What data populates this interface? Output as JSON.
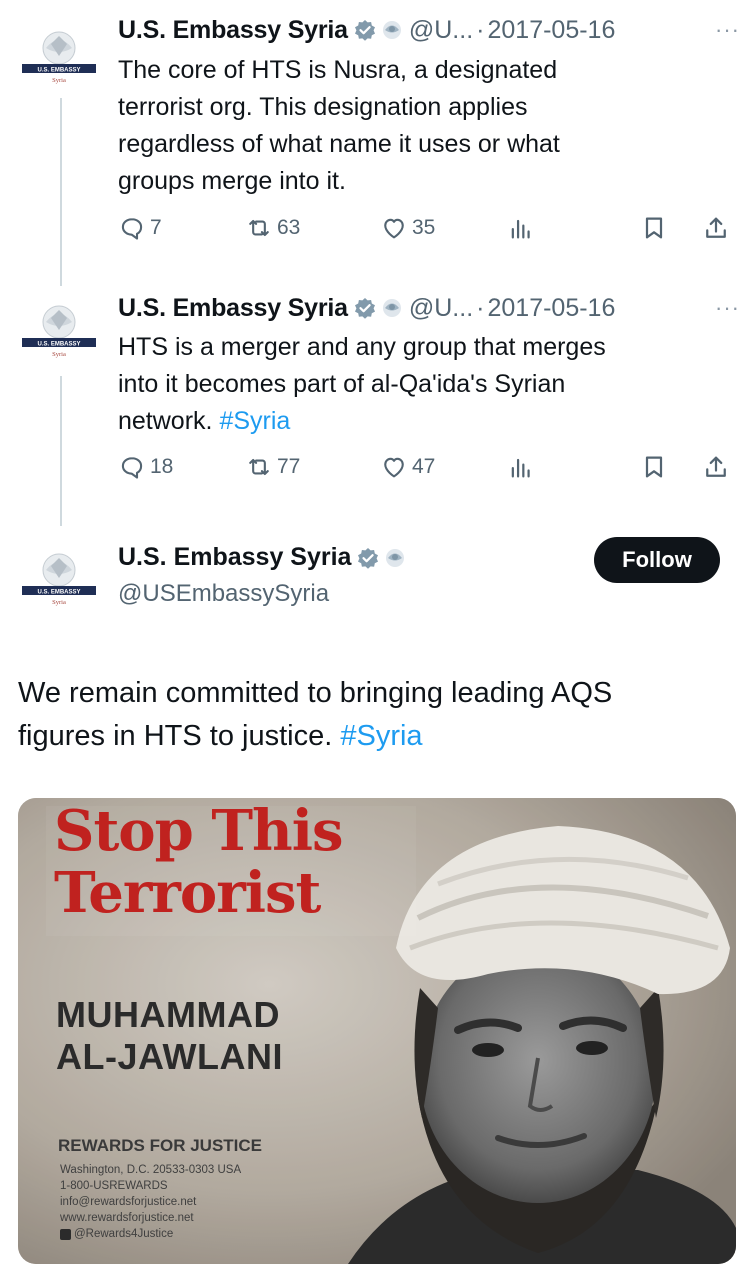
{
  "colors": {
    "accent": "#1d9bf0",
    "text": "#0f1419",
    "muted": "#536471",
    "poster_red": "#c0221f"
  },
  "tweets": [
    {
      "name": "U.S. Embassy Syria",
      "handle": "@U...",
      "separator": "·",
      "date": "2017-05-16",
      "more": "···",
      "text_lines": [
        "The core of HTS is Nusra, a designated",
        "terrorist org. This designation applies",
        "regardless of what name it uses or what",
        "groups merge into it."
      ],
      "replies": "7",
      "retweets": "63",
      "likes": "35",
      "icons": [
        "reply-icon",
        "retweet-icon",
        "like-icon",
        "views-icon",
        "bookmark-icon",
        "share-icon"
      ]
    },
    {
      "name": "U.S. Embassy Syria",
      "handle": "@U...",
      "separator": "·",
      "date": "2017-05-16",
      "more": "···",
      "text_line1": "HTS is a merger and any group that merges",
      "text_line2": "into it becomes part of al-Qa'ida's Syrian",
      "text_line3_prefix": "network. ",
      "hashtag": "#Syria",
      "replies": "18",
      "retweets": "77",
      "likes": "47"
    }
  ],
  "main": {
    "name": "U.S. Embassy Syria",
    "handle": "@USEmbassySyria",
    "follow_label": "Follow",
    "text_line1": "We remain committed to bringing leading AQS",
    "text_line2_prefix": "figures in HTS to justice. ",
    "hashtag": "#Syria"
  },
  "poster": {
    "title_line1": "Stop This",
    "title_line2": "Terrorist",
    "name_line1": "MUHAMMAD",
    "name_line2": "AL-JAWLANI",
    "org": "REWARDS FOR JUSTICE",
    "lines": [
      "Washington, D.C. 20533-0303 USA",
      "1-800-USREWARDS",
      "info@rewardsforjustice.net",
      "www.rewardsforjustice.net",
      "@Rewards4Justice"
    ]
  },
  "avatar": {
    "label_top": "U.S. EMBASSY",
    "label_bottom": "Syria"
  }
}
